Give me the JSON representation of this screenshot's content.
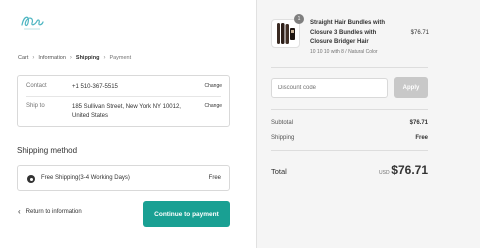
{
  "breadcrumb": {
    "items": [
      "Cart",
      "Information",
      "Shipping",
      "Payment"
    ]
  },
  "review": {
    "contact_label": "Contact",
    "contact_value": "+1 510-367-5515",
    "shipto_label": "Ship to",
    "shipto_value": "185 Sullivan Street, New York NY 10012, United States",
    "change_label": "Change"
  },
  "shipping": {
    "title": "Shipping method",
    "option_label": "Free Shipping(3-4 Working Days)",
    "option_price": "Free"
  },
  "actions": {
    "return_label": "Return to information",
    "continue_label": "Continue to payment"
  },
  "summary": {
    "product": {
      "name": "Straight Hair Bundles with Closure 3 Bundles with Closure Bridger Hair",
      "variant": "10 10 10 with 8 / Natural Color",
      "price": "$76.71",
      "quantity": "1"
    },
    "discount_placeholder": "Discount code",
    "apply_label": "Apply",
    "subtotal_label": "Subtotal",
    "subtotal_value": "$76.71",
    "shipping_label": "Shipping",
    "shipping_value": "Free",
    "total_label": "Total",
    "total_currency": "USD",
    "total_value": "$76.71"
  },
  "colors": {
    "accent": "#19a093",
    "sidebar_bg": "#f5f5f5"
  }
}
